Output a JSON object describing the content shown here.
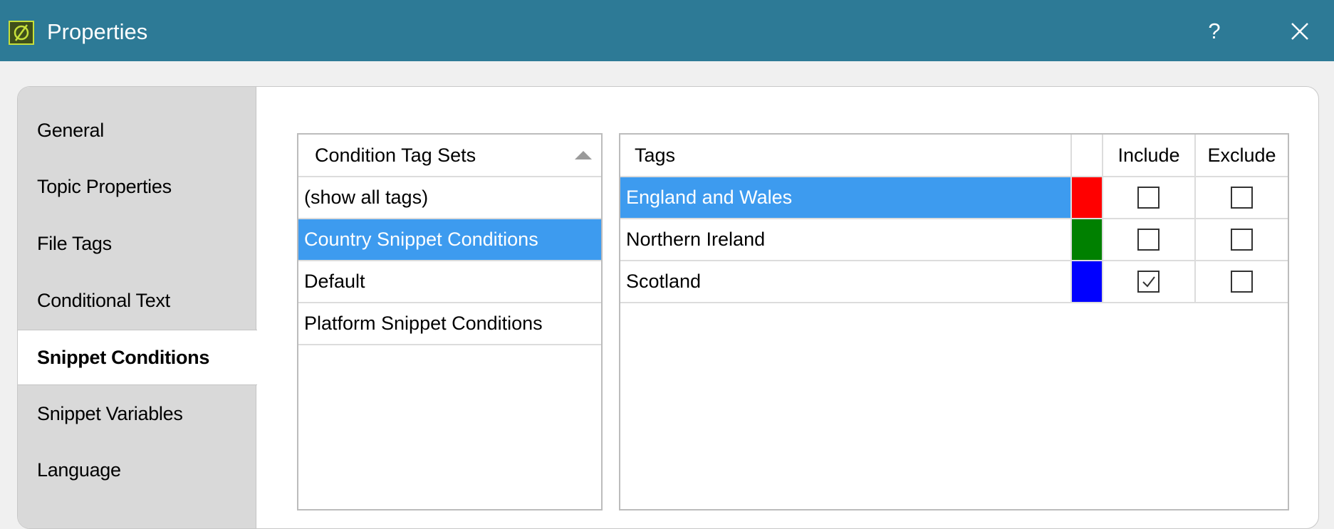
{
  "window": {
    "title": "Properties",
    "help_label": "?",
    "title_bar_color": "#2d7a96"
  },
  "sidebar": {
    "active_item": "Snippet Conditions",
    "items": [
      {
        "label": "General"
      },
      {
        "label": "Topic Properties"
      },
      {
        "label": "File Tags"
      },
      {
        "label": "Conditional Text"
      },
      {
        "label": "Snippet Conditions"
      },
      {
        "label": "Snippet Variables"
      },
      {
        "label": "Language"
      }
    ]
  },
  "tag_sets": {
    "header": "Condition Tag Sets",
    "sort_icon": "sort-ascending-icon",
    "selected": "Country Snippet Conditions",
    "items": [
      {
        "label": "(show all tags)"
      },
      {
        "label": "Country Snippet Conditions"
      },
      {
        "label": "Default"
      },
      {
        "label": "Platform Snippet Conditions"
      }
    ]
  },
  "tags_grid": {
    "columns": {
      "tags": "Tags",
      "include": "Include",
      "exclude": "Exclude"
    },
    "selected": "England and Wales",
    "rows": [
      {
        "name": "England and Wales",
        "color": "#ff0000",
        "include": false,
        "exclude": false
      },
      {
        "name": "Northern Ireland",
        "color": "#008000",
        "include": false,
        "exclude": false
      },
      {
        "name": "Scotland",
        "color": "#0000ff",
        "include": true,
        "exclude": false
      }
    ]
  },
  "colors": {
    "selection": "#3d9bef",
    "sidebar_bg": "#d9d9d9"
  }
}
